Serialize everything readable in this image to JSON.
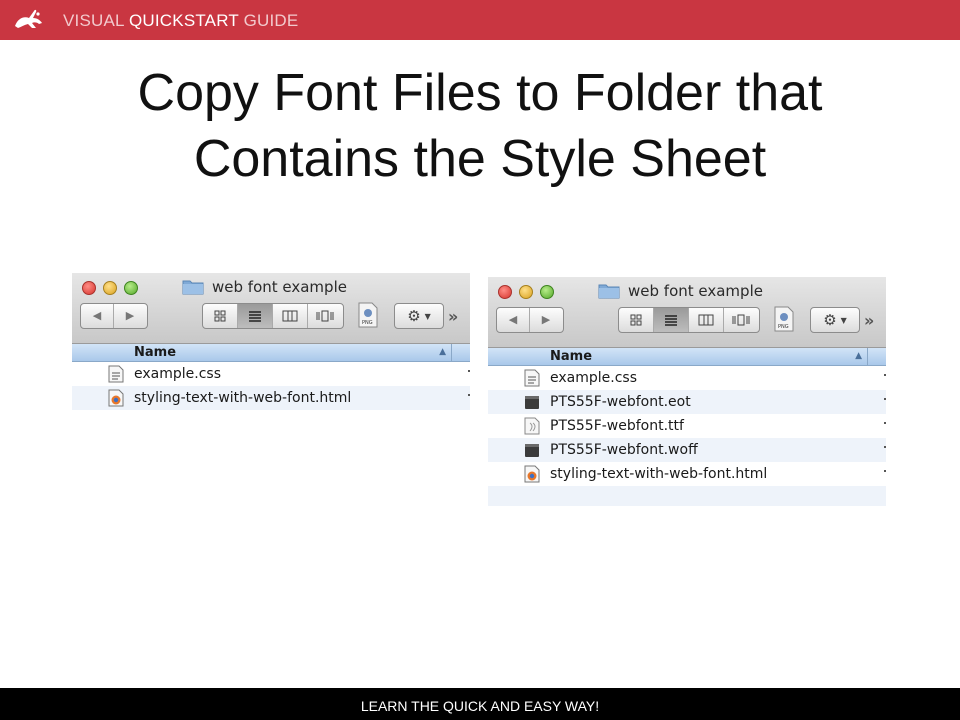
{
  "banner": {
    "brand_word1": "VISUAL",
    "brand_word2": "QUICKSTART",
    "brand_word3": "GUIDE",
    "logo_icon": "rabbit-logo-icon",
    "color": "#c93641"
  },
  "title": {
    "line1": "Copy Font Files to Folder that",
    "line2": "Contains the Style Sheet"
  },
  "finder_left": {
    "window_title": "web font example",
    "column_header": "Name",
    "files": [
      {
        "name": "example.css",
        "icon": "css-file-icon"
      },
      {
        "name": "styling-text-with-web-font.html",
        "icon": "html-file-icon"
      }
    ]
  },
  "finder_right": {
    "window_title": "web font example",
    "column_header": "Name",
    "files": [
      {
        "name": "example.css",
        "icon": "css-file-icon"
      },
      {
        "name": "PTS55F-webfont.eot",
        "icon": "font-file-icon"
      },
      {
        "name": "PTS55F-webfont.ttf",
        "icon": "ttf-file-icon"
      },
      {
        "name": "PTS55F-webfont.woff",
        "icon": "font-file-icon"
      },
      {
        "name": "styling-text-with-web-font.html",
        "icon": "html-file-icon"
      }
    ]
  },
  "footer": {
    "tagline": "LEARN THE QUICK AND EASY WAY!"
  }
}
